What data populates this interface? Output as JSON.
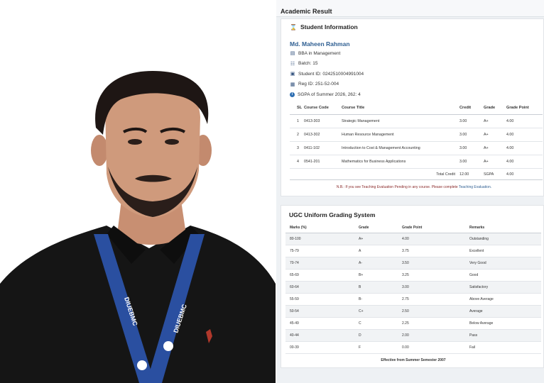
{
  "page": {
    "title": "Academic Result"
  },
  "student": {
    "section_title": "Student Information",
    "name": "Md. Maheen Rahman",
    "program": "BBA in Management",
    "batch": "Batch: 15",
    "student_id": "Student ID: 0242510004991004",
    "reg_id": "Reg ID: 251-52-004",
    "sgpa": "SGPA of Summer 2026, 262: 4"
  },
  "courses": {
    "headers": [
      "SL",
      "Course Code",
      "Course Title",
      "Credit",
      "Grade",
      "Grade Point"
    ],
    "rows": [
      {
        "sl": "1",
        "code": "0413-303",
        "title": "Strategic Management",
        "credit": "3.00",
        "grade": "A+",
        "point": "4.00"
      },
      {
        "sl": "2",
        "code": "0413-302",
        "title": "Human Resource Management",
        "credit": "3.00",
        "grade": "A+",
        "point": "4.00"
      },
      {
        "sl": "3",
        "code": "0411-102",
        "title": "Introduction to Cost & Management Accounting",
        "credit": "3.00",
        "grade": "A+",
        "point": "4.00"
      },
      {
        "sl": "4",
        "code": "0541-201",
        "title": "Mathematics for Business Applications",
        "credit": "3.00",
        "grade": "A+",
        "point": "4.00"
      }
    ],
    "total_label": "Total Credit",
    "total_credit": "12.00",
    "sgpa_label": "SGPA",
    "sgpa_value": "4.00"
  },
  "notice": {
    "text": "N.B.: If you see Teaching Evaluation Pending in any course. Please complete",
    "link": "Teaching Evaluation."
  },
  "ugc": {
    "title": "UGC Uniform Grading System",
    "headers": [
      "Marks (%)",
      "Grade",
      "Grade Point",
      "Remarks"
    ],
    "rows": [
      {
        "marks": "80-100",
        "grade": "A+",
        "point": "4.00",
        "remark": "Outstanding"
      },
      {
        "marks": "75-79",
        "grade": "A",
        "point": "3.75",
        "remark": "Excellent"
      },
      {
        "marks": "70-74",
        "grade": "A-",
        "point": "3.50",
        "remark": "Very Good"
      },
      {
        "marks": "65-69",
        "grade": "B+",
        "point": "3.25",
        "remark": "Good"
      },
      {
        "marks": "60-64",
        "grade": "B",
        "point": "3.00",
        "remark": "Satisfactory"
      },
      {
        "marks": "55-59",
        "grade": "B-",
        "point": "2.75",
        "remark": "Above Average"
      },
      {
        "marks": "50-54",
        "grade": "C+",
        "point": "2.50",
        "remark": "Average"
      },
      {
        "marks": "45-49",
        "grade": "C",
        "point": "2.25",
        "remark": "Below Average"
      },
      {
        "marks": "40-44",
        "grade": "D",
        "point": "2.00",
        "remark": "Pass"
      },
      {
        "marks": "00-39",
        "grade": "F",
        "point": "0.00",
        "remark": "Fail"
      }
    ],
    "footer": "Effective from Summer Semester 2007"
  },
  "photo": {
    "lanyard_text": "DIUEBMC"
  },
  "colors": {
    "accent": "#2f5f92",
    "lanyard": "#2a4fa0",
    "shirt": "#151515"
  }
}
